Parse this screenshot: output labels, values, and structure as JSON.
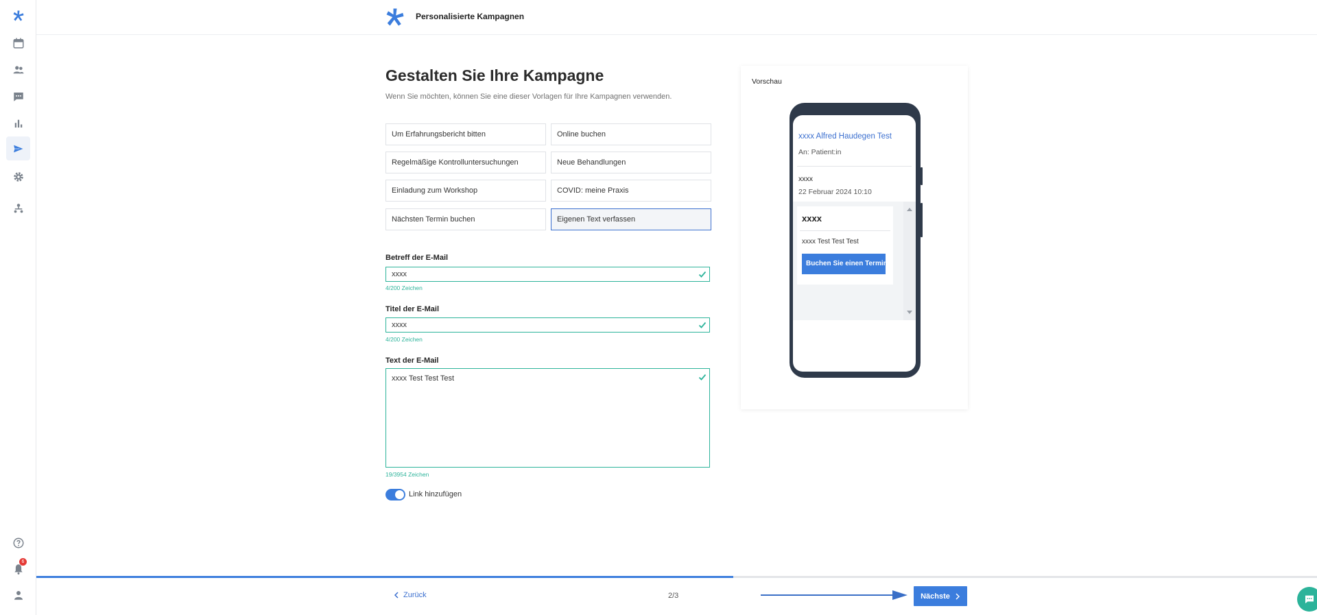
{
  "app": {
    "title": "Personalisierte Kampagnen",
    "brand_color": "#3b7ddd",
    "success_color": "#2cb39a"
  },
  "sidebar": {
    "items": [
      {
        "icon": "logo-icon"
      },
      {
        "icon": "calendar-icon"
      },
      {
        "icon": "people-icon"
      },
      {
        "icon": "chat-icon"
      },
      {
        "icon": "bar-chart-icon"
      },
      {
        "icon": "send-icon",
        "active": true
      },
      {
        "icon": "gear-icon"
      },
      {
        "icon": "org-icon"
      }
    ],
    "bottom": [
      {
        "icon": "help-icon"
      },
      {
        "icon": "bell-icon",
        "badge": "6"
      },
      {
        "icon": "user-icon"
      }
    ]
  },
  "main": {
    "heading": "Gestalten Sie Ihre Kampagne",
    "subheading": "Wenn Sie möchten, können Sie eine dieser Vorlagen für Ihre Kampagnen verwenden.",
    "templates": [
      "Um Erfahrungsbericht bitten",
      "Online buchen",
      "Regelmäßige Kontrolluntersuchungen",
      "Neue Behandlungen",
      "Einladung zum Workshop",
      "COVID: meine Praxis",
      "Nächsten Termin buchen",
      "Eigenen Text verfassen"
    ],
    "selected_template": "Eigenen Text verfassen",
    "subject": {
      "label": "Betreff der E-Mail",
      "value": "xxxx",
      "counter": "4/200 Zeichen"
    },
    "title_field": {
      "label": "Titel der E-Mail",
      "value": "xxxx",
      "counter": "4/200 Zeichen"
    },
    "body": {
      "label": "Text der E-Mail",
      "value": "xxxx Test Test Test",
      "counter": "19/3954 Zeichen"
    },
    "toggle": {
      "label": "Link hinzufügen",
      "on": true
    }
  },
  "preview": {
    "title": "Vorschau",
    "sender": "xxxx Alfred Haudegen Test",
    "to": "An: Patient:in",
    "subject": "xxxx",
    "date": "22 Februar 2024 10:10",
    "card_title": "xxxx",
    "card_text": "xxxx Test Test Test",
    "card_button": "Buchen Sie einen Termin"
  },
  "footer": {
    "back_label": "Zurück",
    "step": "2/3",
    "next_label": "Nächste",
    "progress": 0.544
  }
}
